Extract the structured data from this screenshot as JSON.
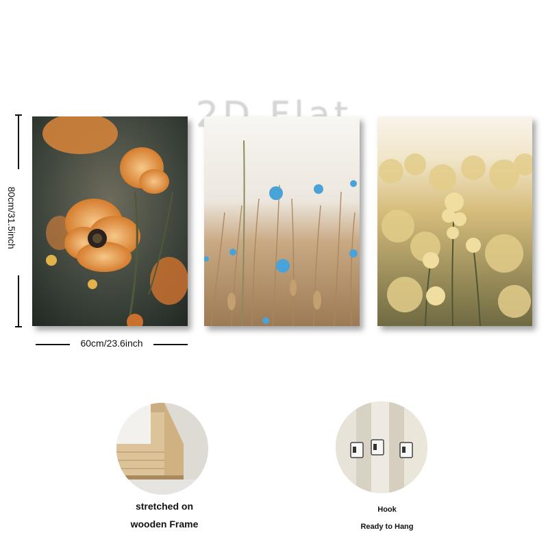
{
  "watermark": "2D Flat",
  "dimensions": {
    "height_label": "80cm/31.5inch",
    "width_label": "60cm/23.6inch"
  },
  "panels": [
    {
      "subject": "orange poppy flowers",
      "palette": [
        "#2f3a33",
        "#d98b3c",
        "#e8a45c"
      ]
    },
    {
      "subject": "blue cornflowers in wheat field",
      "palette": [
        "#f3f1ec",
        "#b8956a",
        "#4aa3d8"
      ]
    },
    {
      "subject": "yellow rapeseed blossoms",
      "palette": [
        "#f5f0e2",
        "#cdb26d",
        "#5d5a3a"
      ]
    }
  ],
  "features": {
    "frame": {
      "line1": "stretched on",
      "line2": "wooden Frame"
    },
    "hook": {
      "line1": "Hook",
      "line2": "Ready to Hang"
    }
  }
}
